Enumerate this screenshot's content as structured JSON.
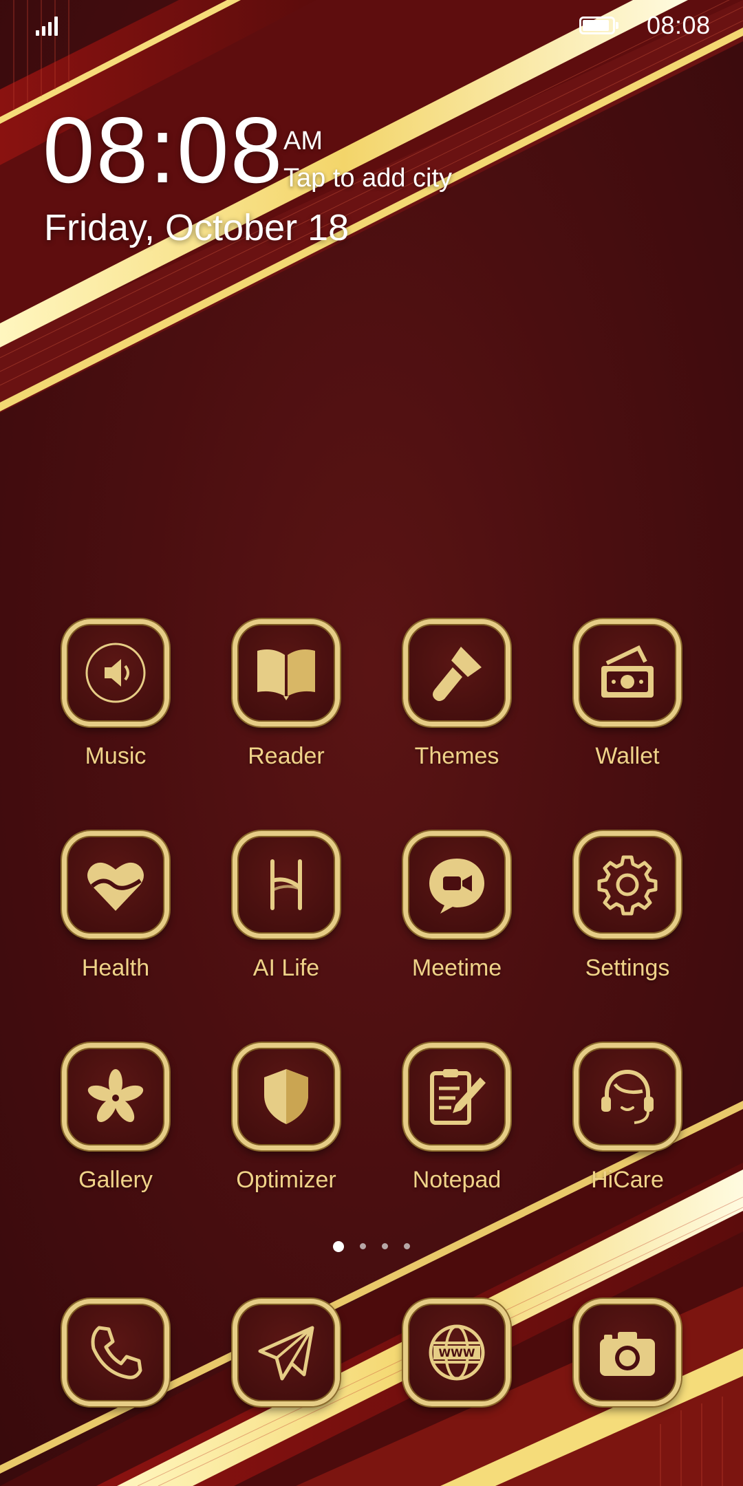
{
  "status_bar": {
    "time": "08:08",
    "signal_icon": "signal-bars-icon",
    "battery_icon": "battery-full-icon"
  },
  "lock_widget": {
    "time": "08:08",
    "ampm": "AM",
    "city_prompt": "Tap to add city",
    "date": "Friday, October 18"
  },
  "apps": [
    {
      "label": "Music",
      "icon": "speaker-icon"
    },
    {
      "label": "Reader",
      "icon": "open-book-icon"
    },
    {
      "label": "Themes",
      "icon": "paintbrush-icon"
    },
    {
      "label": "Wallet",
      "icon": "wallet-cash-icon"
    },
    {
      "label": "Health",
      "icon": "heart-icon"
    },
    {
      "label": "AI Life",
      "icon": "ai-life-icon"
    },
    {
      "label": "Meetime",
      "icon": "video-chat-icon"
    },
    {
      "label": "Settings",
      "icon": "gear-icon"
    },
    {
      "label": "Gallery",
      "icon": "flower-icon"
    },
    {
      "label": "Optimizer",
      "icon": "shield-icon"
    },
    {
      "label": "Notepad",
      "icon": "notepad-pencil-icon"
    },
    {
      "label": "HiCare",
      "icon": "headset-icon"
    }
  ],
  "page_indicator": {
    "count": 4,
    "active_index": 0
  },
  "dock": [
    {
      "label": "Phone",
      "icon": "phone-icon"
    },
    {
      "label": "Messaging",
      "icon": "paper-plane-icon"
    },
    {
      "label": "Browser",
      "icon": "globe-www-icon"
    },
    {
      "label": "Camera",
      "icon": "camera-icon"
    }
  ],
  "colors": {
    "background": "#4a0e10",
    "gold": "#e6cd86",
    "label_gold": "#f0d389"
  }
}
